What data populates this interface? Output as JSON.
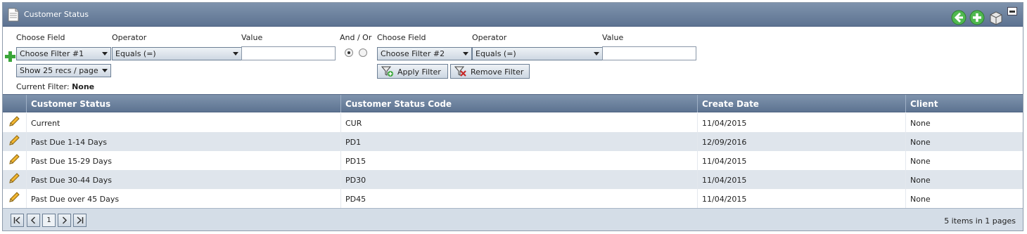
{
  "window": {
    "title": "Customer Status"
  },
  "filters": {
    "labels": {
      "choose_field_1": "Choose Field",
      "operator_1": "Operator",
      "value_1": "Value",
      "and_or": "And / Or",
      "choose_field_2": "Choose Field",
      "operator_2": "Operator",
      "value_2": "Value"
    },
    "field_1": "Choose Filter #1",
    "operator_1": "Equals (=)",
    "value_1": "",
    "field_2": "Choose Filter #2",
    "operator_2": "Equals (=)",
    "value_2": "",
    "page_size": "Show 25 recs / page",
    "apply_label": "Apply Filter",
    "remove_label": "Remove Filter",
    "current_filter_label": "Current Filter:",
    "current_filter_value": "None",
    "and_or_selected": "And"
  },
  "grid": {
    "columns": [
      "Customer Status",
      "Customer Status Code",
      "Create Date",
      "Client"
    ],
    "rows": [
      [
        "Current",
        "CUR",
        "11/04/2015",
        "None"
      ],
      [
        "Past Due 1-14 Days",
        "PD1",
        "12/09/2016",
        "None"
      ],
      [
        "Past Due 15-29 Days",
        "PD15",
        "11/04/2015",
        "None"
      ],
      [
        "Past Due 30-44 Days",
        "PD30",
        "11/04/2015",
        "None"
      ],
      [
        "Past Due over 45 Days",
        "PD45",
        "11/04/2015",
        "None"
      ]
    ]
  },
  "pager": {
    "current_page": "1",
    "info_count": "5",
    "info_mid": " items in ",
    "info_pages": "1",
    "info_end": " pages"
  },
  "colors": {
    "header_bg": "#6a7f9b",
    "row_alt": "#dfe5ec",
    "accent_green": "#3aa63a"
  },
  "icons": [
    "document-icon",
    "back-arrow-icon",
    "add-icon",
    "export-icon",
    "minimize-icon",
    "edit-pencil-icon",
    "apply-filter-icon",
    "remove-filter-icon"
  ]
}
